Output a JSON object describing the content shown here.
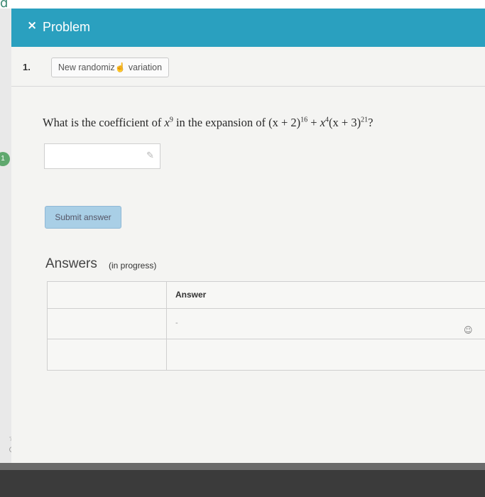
{
  "top_edge": {
    "text": "d"
  },
  "header": {
    "close_icon": "×",
    "title": "Problem"
  },
  "problem": {
    "number": "1.",
    "variation_label_a": "New randomiz",
    "variation_label_b": "variation"
  },
  "question": {
    "intro": "What is the coefficient of",
    "var": "x",
    "var_exp": "9",
    "mid": "in the expansion of",
    "term1": "(x + 2)",
    "term1_exp": "16",
    "plus": "+",
    "term2_var": "x",
    "term2_exp": "4",
    "term3": "(x + 3)",
    "term3_exp": "21",
    "end": "?"
  },
  "answer_input": {
    "value": ""
  },
  "submit": {
    "label": "Submit answer"
  },
  "answers": {
    "heading": "Answers",
    "status": "(in progress)",
    "table": {
      "header": "Answer",
      "cell": "-"
    }
  },
  "left_strip": {
    "badge": "1"
  },
  "icons": {
    "close": "close-icon",
    "pencil": "pencil-icon",
    "answer_mark": "answer-mark-icon",
    "star": "star-icon",
    "circle": "circle-icon"
  },
  "colors": {
    "header": "#2aa0bf",
    "submit": "#a9cfe6",
    "badge": "#5fa86e"
  }
}
